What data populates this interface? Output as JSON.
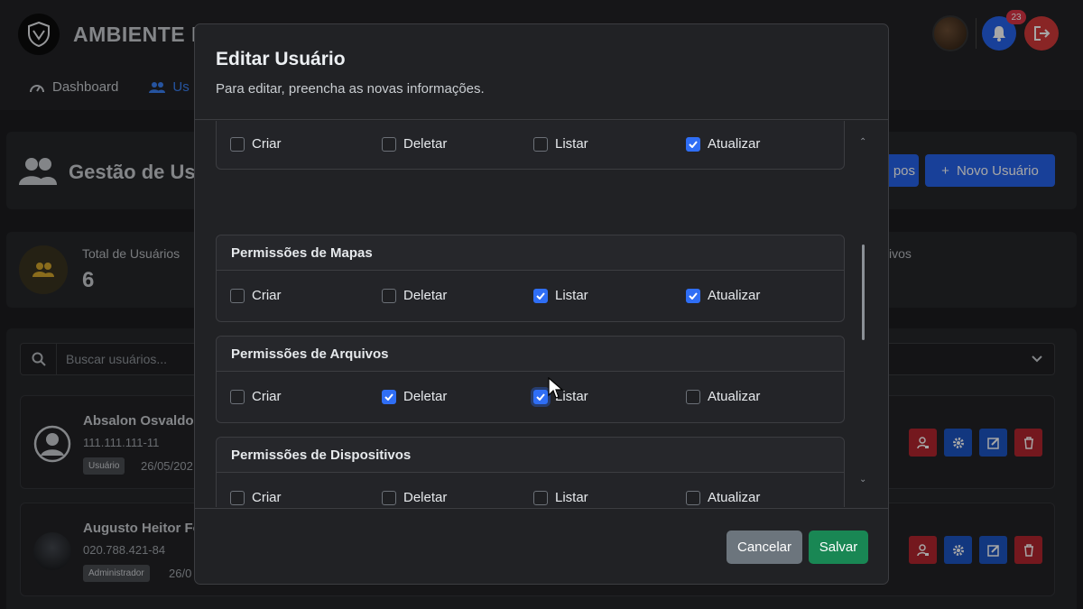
{
  "app": {
    "brand": "AMBIENTE D",
    "nav": [
      {
        "label": "Dashboard",
        "icon": "gauge-icon"
      },
      {
        "label": "Us",
        "icon": "users-icon"
      }
    ],
    "notifications_count": "23"
  },
  "page": {
    "title": "Gestão de Us",
    "groups_button_label": "pos",
    "new_user_button_label": "Novo Usuário",
    "stats": {
      "total_label": "Total de Usuários",
      "total_value": "6",
      "right_label": "ivos"
    },
    "search_placeholder": "Buscar usuários...",
    "users": [
      {
        "name": "Absalon Osvaldo",
        "cpf": "111.111.111-11",
        "role": "Usuário",
        "date": "26/05/202"
      },
      {
        "name": "Augusto Heitor Fo",
        "cpf": "020.788.421-84",
        "role": "Administrador",
        "date": "26/0"
      }
    ]
  },
  "modal": {
    "title": "Editar Usuário",
    "subtitle": "Para editar, preencha as novas informações.",
    "sections": [
      {
        "title": "",
        "options": [
          {
            "label": "Criar",
            "checked": false
          },
          {
            "label": "Deletar",
            "checked": false
          },
          {
            "label": "Listar",
            "checked": false
          },
          {
            "label": "Atualizar",
            "checked": true
          }
        ]
      },
      {
        "title": "Permissões de Mapas",
        "options": [
          {
            "label": "Criar",
            "checked": false
          },
          {
            "label": "Deletar",
            "checked": false
          },
          {
            "label": "Listar",
            "checked": true
          },
          {
            "label": "Atualizar",
            "checked": true
          }
        ]
      },
      {
        "title": "Permissões de Arquivos",
        "options": [
          {
            "label": "Criar",
            "checked": false
          },
          {
            "label": "Deletar",
            "checked": true
          },
          {
            "label": "Listar",
            "checked": true
          },
          {
            "label": "Atualizar",
            "checked": false
          }
        ]
      },
      {
        "title": "Permissões de Dispositivos",
        "options": [
          {
            "label": "Criar",
            "checked": false
          },
          {
            "label": "Deletar",
            "checked": false
          },
          {
            "label": "Listar",
            "checked": false
          },
          {
            "label": "Atualizar",
            "checked": false
          }
        ]
      }
    ],
    "cancel_label": "Cancelar",
    "save_label": "Salvar"
  },
  "colors": {
    "primary": "#2563eb",
    "danger": "#dc3545",
    "success": "#198754",
    "secondary": "#6c757d",
    "modal_bg": "#212225"
  }
}
